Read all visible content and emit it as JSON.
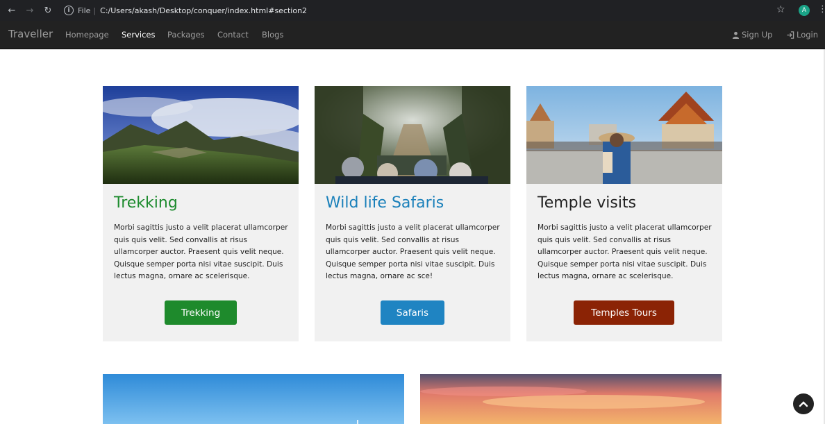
{
  "browser": {
    "file_label": "File",
    "separator": "|",
    "url": "C:/Users/akash/Desktop/conquer/index.html#section2",
    "profile_initial": "A"
  },
  "navbar": {
    "brand": "Traveller",
    "links": [
      "Homepage",
      "Services",
      "Packages",
      "Contact",
      "Blogs"
    ],
    "active": "Services",
    "signup": "Sign Up",
    "login": "Login"
  },
  "cards": [
    {
      "title": "Trekking",
      "title_color": "#1d8b2e",
      "text": "Morbi sagittis justo a velit placerat ullamcorper quis quis velit. Sed convallis at risus ullamcorper auctor. Praesent quis velit neque. Quisque semper porta nisi vitae suscipit. Duis lectus magna, ornare ac scelerisque.",
      "button": "Trekking",
      "button_color": "#1e8a2c"
    },
    {
      "title": "Wild life Safaris",
      "title_color": "#1a80ba",
      "text": "Morbi sagittis justo a velit placerat ullamcorper quis quis velit. Sed convallis at risus ullamcorper auctor. Praesent quis velit neque. Quisque semper porta nisi vitae suscipit. Duis lectus magna, ornare ac sce!",
      "button": "Safaris",
      "button_color": "#1f84c2"
    },
    {
      "title": "Temple visits",
      "title_color": "#222222",
      "text": "Morbi sagittis justo a velit placerat ullamcorper quis quis velit. Sed convallis at risus ullamcorper auctor. Praesent quis velit neque. Quisque semper porta nisi vitae suscipit. Duis lectus magna, ornare ac scelerisque.",
      "button": "Temples Tours",
      "button_color": "#8b2305"
    }
  ]
}
